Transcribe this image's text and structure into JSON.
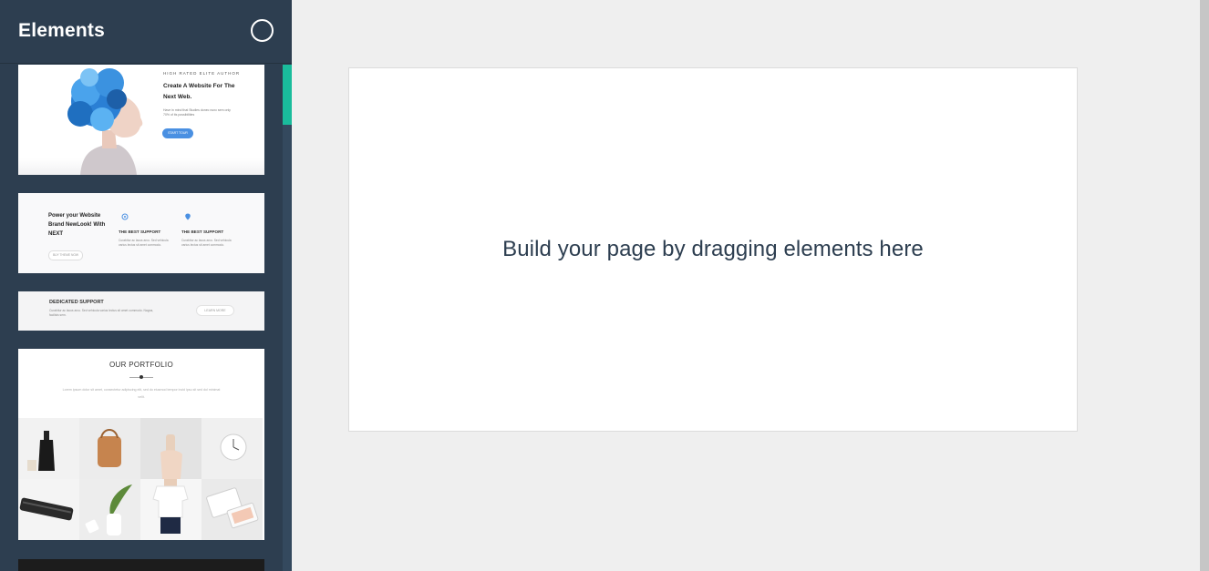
{
  "sidebar": {
    "title": "Elements",
    "thumbnails": {
      "hero": {
        "eyebrow": "HIGH RATED ELITE AUTHOR",
        "headline": "Create A Website For The Next Web.",
        "description": "Have in mind that Studies donec nunc sem only 70% of its possibilities",
        "button": "START TOUR"
      },
      "features": {
        "title": "Power your Website Brand NewLook! With NEXT",
        "button": "BUY THEME NOW",
        "feature_1_title": "THE BEST SUPPORT",
        "feature_1_desc": "Curabitur ac lacus arcu. Sed vehicula varius lectus sit amet commodo.",
        "feature_2_title": "THE BEST SUPPORT",
        "feature_2_desc": "Curabitur ac lacus arcu. Sed vehicula varius lectus sit amet commodo."
      },
      "banner": {
        "title": "DEDICATED SUPPORT",
        "description": "Curabitur ac lacus arcu. Sed vehicula varius lectus sit amet commodo. Nagna, facilisis sem.",
        "button": "LEARN MORE"
      },
      "portfolio": {
        "title": "OUR PORTFOLIO",
        "subtitle": "Lorem ipsum dolor sit amet, consectetur adipiscing elit, sed do eiusmod tempor incid ipsu sit sed dol minimat velit."
      }
    }
  },
  "canvas": {
    "placeholder": "Build your page by dragging elements here"
  },
  "colors": {
    "sidebar_bg": "#2d3e50",
    "scroll_accent": "#1abc9c",
    "main_bg": "#efefef"
  },
  "icons": [
    "close-circle-icon",
    "support-icon",
    "location-pin-icon"
  ]
}
